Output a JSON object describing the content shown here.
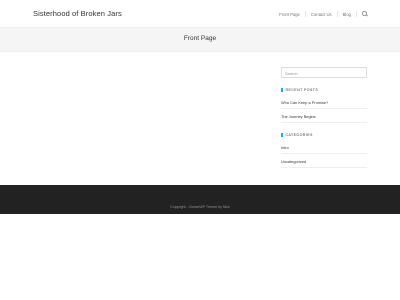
{
  "header": {
    "site_title": "Sisterhood of Broken Jars",
    "nav": {
      "items": [
        "Front Page",
        "Contact Us",
        "Blog"
      ]
    }
  },
  "page": {
    "title": "Front Page"
  },
  "sidebar": {
    "search": {
      "placeholder": "Search"
    },
    "recent_posts": {
      "title": "Recent Posts",
      "items": [
        "Who Can Keep a Promise?",
        "The Journey Begins"
      ]
    },
    "categories": {
      "title": "Categories",
      "items": [
        "Intro",
        "Uncategorized"
      ]
    }
  },
  "footer": {
    "copyright": "Copyright - OceanWP Theme by Nick"
  },
  "colors": {
    "accent": "#13aff0",
    "footer_bg": "#222222",
    "banner_bg": "#f5f5f5"
  }
}
